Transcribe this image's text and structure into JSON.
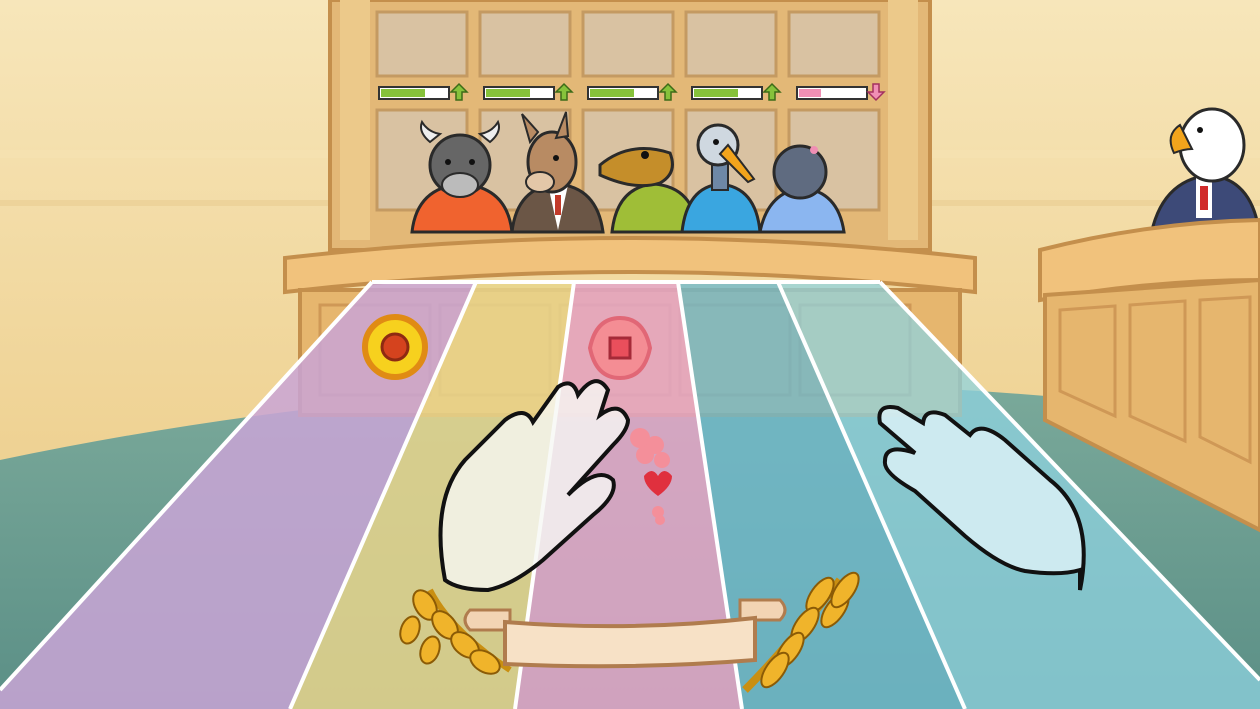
{
  "colors": {
    "wall": "#f1dba0",
    "floor": "#6fa79a",
    "wood": "#e8b56a",
    "wood_dark": "#c88b45",
    "lane_purple": "#c9a5d6",
    "lane_yellow": "#e8d58c",
    "lane_pink": "#e4a6c8",
    "lane_teal": "#6fb9cc",
    "lane_blue": "#8fd3e0",
    "meter_green": "#86c23b",
    "meter_pink": "#f08fb4"
  },
  "jury": [
    {
      "animal": "bull",
      "shirt": "#f0632f",
      "approval": 0.62,
      "trend": "up"
    },
    {
      "animal": "donkey",
      "shirt": "#6b5646",
      "approval": 0.62,
      "trend": "up"
    },
    {
      "animal": "crocodile",
      "shirt": "#9fbe37",
      "approval": 0.62,
      "trend": "up"
    },
    {
      "animal": "heron",
      "shirt": "#3aa6e0",
      "approval": 0.62,
      "trend": "up"
    },
    {
      "animal": "mole",
      "shirt": "#8bb6f0",
      "approval": 0.18,
      "trend": "down"
    }
  ],
  "judge": {
    "animal": "eagle"
  },
  "lanes": [
    {
      "color": "#c9a5d6",
      "button": "circle",
      "button_color": "#f2a018"
    },
    {
      "color": "#e8d58c",
      "button": "none"
    },
    {
      "color": "#e4a6c8",
      "button": "square",
      "button_color": "#f07a86"
    },
    {
      "color": "#6fb9cc",
      "button": "none"
    },
    {
      "color": "#8fd3e0",
      "button": "none"
    }
  ],
  "hands": {
    "left": "left-hand",
    "right": "right-hand"
  },
  "banner": {
    "label": ""
  },
  "icons": [
    "circle-note-icon",
    "square-note-icon",
    "up-arrow-icon",
    "down-arrow-icon",
    "laurel-icon",
    "wheat-icon",
    "heart-icon"
  ]
}
